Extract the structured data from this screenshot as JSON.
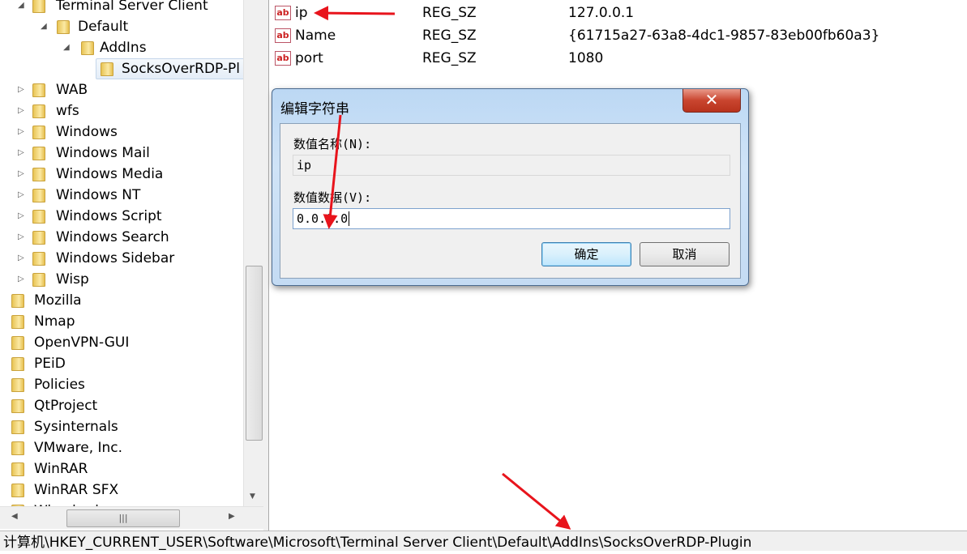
{
  "tree": {
    "items": [
      {
        "label": "Terminal Server Client",
        "level": 1,
        "expander": "expanded"
      },
      {
        "label": "Default",
        "level": 2,
        "expander": "expanded"
      },
      {
        "label": "AddIns",
        "level": 3,
        "expander": "expanded"
      },
      {
        "label": "SocksOverRDP-Pl",
        "level": 4,
        "expander": "none",
        "selected": true
      },
      {
        "label": "WAB",
        "level": 1,
        "expander": "collapsed"
      },
      {
        "label": "wfs",
        "level": 1,
        "expander": "collapsed"
      },
      {
        "label": "Windows",
        "level": 1,
        "expander": "collapsed"
      },
      {
        "label": "Windows Mail",
        "level": 1,
        "expander": "collapsed"
      },
      {
        "label": "Windows Media",
        "level": 1,
        "expander": "collapsed"
      },
      {
        "label": "Windows NT",
        "level": 1,
        "expander": "collapsed"
      },
      {
        "label": "Windows Script",
        "level": 1,
        "expander": "collapsed"
      },
      {
        "label": "Windows Search",
        "level": 1,
        "expander": "collapsed"
      },
      {
        "label": "Windows Sidebar",
        "level": 1,
        "expander": "collapsed"
      },
      {
        "label": "Wisp",
        "level": 1,
        "expander": "collapsed"
      },
      {
        "label": "Mozilla",
        "level": 0,
        "expander": "none"
      },
      {
        "label": "Nmap",
        "level": 0,
        "expander": "none"
      },
      {
        "label": "OpenVPN-GUI",
        "level": 0,
        "expander": "none"
      },
      {
        "label": "PEiD",
        "level": 0,
        "expander": "none"
      },
      {
        "label": "Policies",
        "level": 0,
        "expander": "none"
      },
      {
        "label": "QtProject",
        "level": 0,
        "expander": "none"
      },
      {
        "label": "Sysinternals",
        "level": 0,
        "expander": "none"
      },
      {
        "label": "VMware, Inc.",
        "level": 0,
        "expander": "none"
      },
      {
        "label": "WinRAR",
        "level": 0,
        "expander": "none"
      },
      {
        "label": "WinRAR SFX",
        "level": 0,
        "expander": "none"
      },
      {
        "label": "Wireshark",
        "level": 0,
        "expander": "none"
      }
    ]
  },
  "values": [
    {
      "icon": "string-value-icon",
      "name": "ip",
      "type": "REG_SZ",
      "data": "127.0.0.1"
    },
    {
      "icon": "string-value-icon",
      "name": "Name",
      "type": "REG_SZ",
      "data": "{61715a27-63a8-4dc1-9857-83eb00fb60a3}"
    },
    {
      "icon": "string-value-icon",
      "name": "port",
      "type": "REG_SZ",
      "data": "1080"
    }
  ],
  "dialog": {
    "title": "编辑字符串",
    "name_label": "数值名称(N):",
    "name_value": "ip",
    "data_label": "数值数据(V):",
    "data_value": "0.0.0.0",
    "ok": "确定",
    "cancel": "取消",
    "close": "✕"
  },
  "status": {
    "path": "计算机\\HKEY_CURRENT_USER\\Software\\Microsoft\\Terminal Server Client\\Default\\AddIns\\SocksOverRDP-Plugin"
  },
  "colors": {
    "annotation_arrow": "#e8141c",
    "selection": "#e4edf7"
  }
}
